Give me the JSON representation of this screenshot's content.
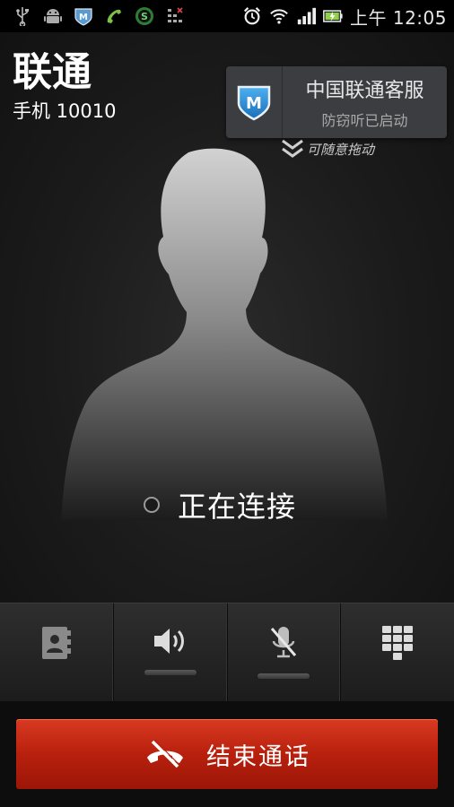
{
  "status_bar": {
    "left_icons": [
      "usb-icon",
      "android-debug-icon",
      "shield-m-icon",
      "missed-call-icon",
      "s-app-icon",
      "sim-toolkit-icon"
    ],
    "right_icons": [
      "alarm-icon",
      "wifi-icon",
      "signal-icon",
      "battery-charging-icon"
    ],
    "time": "上午 12:05"
  },
  "caller": {
    "name": "联通",
    "number": "手机 10010"
  },
  "popup": {
    "title": "中国联通客服",
    "subtitle": "防窃听已启动",
    "drag_hint": "可随意拖动"
  },
  "call_status": "正在连接",
  "controls": [
    {
      "name": "contacts",
      "icon": "contacts-icon",
      "has_indicator": false
    },
    {
      "name": "speaker",
      "icon": "speaker-icon",
      "has_indicator": true
    },
    {
      "name": "mute",
      "icon": "mute-mic-icon",
      "has_indicator": true
    },
    {
      "name": "dialpad",
      "icon": "dialpad-icon",
      "has_indicator": false
    }
  ],
  "end_call": {
    "label": "结束通话",
    "color": "#c0260f"
  },
  "colors": {
    "background": "#141414",
    "popup": "#3b3d41",
    "accent_blue": "#2a8fd6"
  }
}
